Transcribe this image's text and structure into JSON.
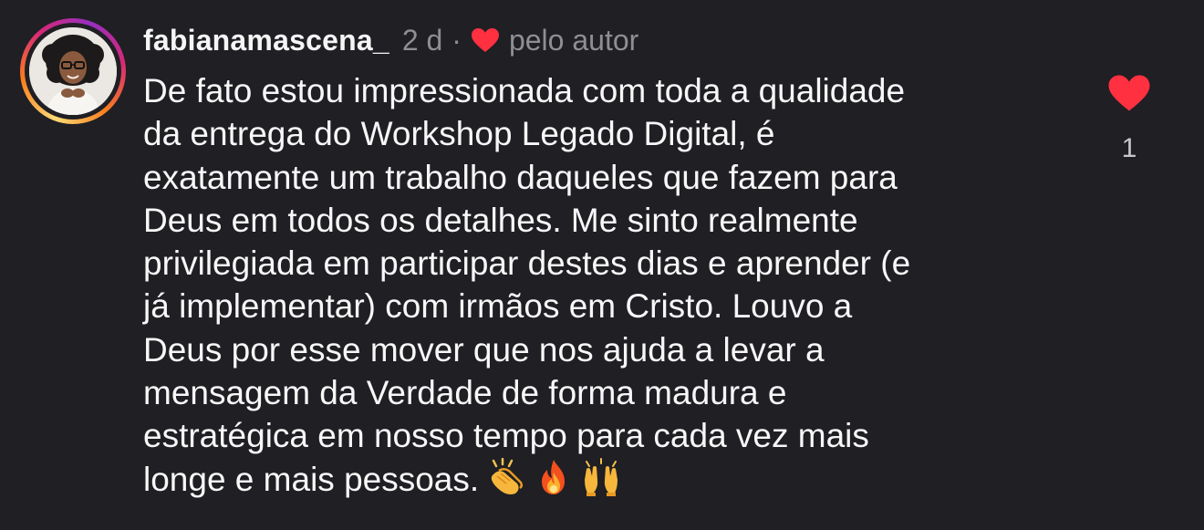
{
  "comment": {
    "username": "fabianamascena_",
    "time": "2 d",
    "separator": "·",
    "liked_by_author_label": "pelo autor",
    "liked_by_author_icon": "heart-filled-icon",
    "text_lines": [
      "De fato estou impressionada com toda a qualidade",
      "da entrega do Workshop Legado Digital, é",
      "exatamente um trabalho daqueles que fazem para",
      "Deus em todos os detalhes. Me sinto realmente",
      "privilegiada em participar destes dias e aprender (e",
      "já implementar) com irmãos em Cristo. Louvo a",
      "Deus por esse mover que nos ajuda a levar a",
      "mensagem da Verdade de forma madura e",
      "estratégica em nosso tempo para cada vez mais",
      "longe e mais pessoas."
    ],
    "emojis": [
      "clapping-hands-icon",
      "fire-icon",
      "raising-hands-icon"
    ],
    "like_icon": "heart-filled-icon",
    "like_count": "1"
  },
  "colors": {
    "background": "#1f1f24",
    "text": "#f5f5f5",
    "muted": "#8e8e93",
    "heart": "#ff3040"
  }
}
